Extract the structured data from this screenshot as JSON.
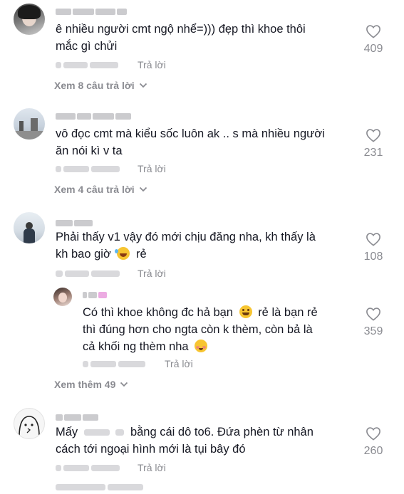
{
  "comments": [
    {
      "text_line1": "ê nhiều người cmt ngộ nhể=))) đẹp thì khoe thôi",
      "text_line2": "mắc gì chửi",
      "reply_label": "Trả lời",
      "likes": "409",
      "view_replies": "Xem 8 câu trả lời"
    },
    {
      "text_line1": "vô đọc cmt mà kiểu sốc luôn ak .. s mà nhiều người",
      "text_line2": "ăn nói kì v ta",
      "reply_label": "Trả lời",
      "likes": "231",
      "view_replies": "Xem 4 câu trả lời"
    },
    {
      "text_line1": "Phải thấy v1 vậy đó mới chịu đăng nha, kh thấy là",
      "text_line2_a": "kh bao giờ",
      "text_line2_b": "rẻ",
      "reply_label": "Trả lời",
      "likes": "108"
    },
    {
      "text_line1_a": "Có thì khoe không đc hả bạn",
      "text_line1_b": "rẻ là bạn rẻ",
      "text_line2": "thì đúng hơn cho ngta còn k thèm, còn bả là",
      "text_line3": "cả khối ng thèm nha",
      "reply_label": "Trả lời",
      "likes": "359",
      "view_more": "Xem thêm 49"
    },
    {
      "text_line1_a": "Mấy",
      "text_line1_b": "bằng cái dô to6. Đứa phèn từ nhân",
      "text_line2": "cách tới ngoại hình mới là tụi bây đó",
      "reply_label": "Trả lời",
      "likes": "260"
    }
  ]
}
